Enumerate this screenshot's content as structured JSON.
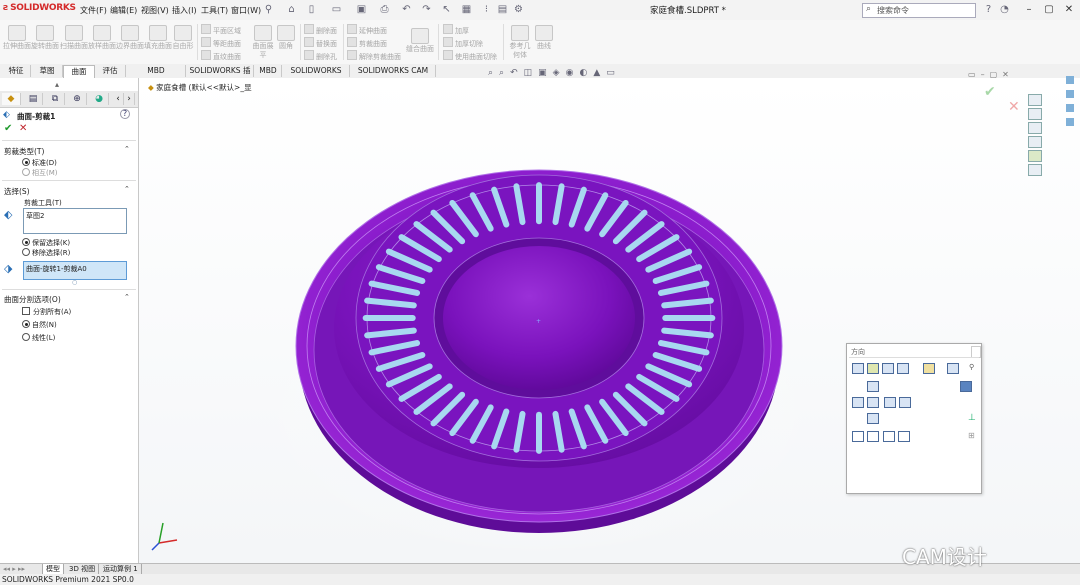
{
  "app": {
    "logo": "SOLIDWORKS",
    "document_title": "家庭食槽.SLDPRT *"
  },
  "menu": [
    "文件(F)",
    "编辑(E)",
    "视图(V)",
    "插入(I)",
    "工具(T)",
    "窗口(W)"
  ],
  "search": {
    "placeholder": "搜索命令"
  },
  "ribbon": {
    "large": [
      "拉伸曲面",
      "旋转曲面",
      "扫描曲面",
      "放样曲面",
      "边界曲面",
      "填充曲面",
      "自由形"
    ],
    "small_a": [
      "平面区域",
      "等距曲面",
      "直纹曲面"
    ],
    "large_b": [
      "曲面展平",
      "圆角"
    ],
    "small_b": [
      "删除面",
      "替换面",
      "删除孔"
    ],
    "small_c": [
      "延伸曲面",
      "剪裁曲面",
      "解除剪裁曲面"
    ],
    "large_c": "缝合曲面",
    "small_d": [
      "加厚",
      "加厚切除",
      "使用曲面切除"
    ],
    "large_d": [
      "参考几何体",
      "曲线"
    ]
  },
  "tabs": [
    "特征",
    "草图",
    "曲面",
    "评估",
    "MBD Dimensions",
    "SOLIDWORKS 插件",
    "MBD",
    "SOLIDWORKS CAM",
    "SOLIDWORKS CAM TBM"
  ],
  "active_tab": "曲面",
  "panel": {
    "title": "曲面-剪裁1",
    "trim_type": {
      "header": "剪裁类型(T)",
      "options": [
        "标准(D)",
        "相互(M)"
      ],
      "selected": "标准(D)"
    },
    "selection": {
      "header": "选择(S)",
      "trim_tool_label": "剪裁工具(T)",
      "trim_tool_value": "草图2",
      "options": [
        "保留选择(K)",
        "移除选择(R)"
      ],
      "selected": "保留选择(K)",
      "faces_value": "曲面-旋转1-剪裁A0"
    },
    "split": {
      "header": "曲面分割选项(O)",
      "split_all": "分割所有(A)",
      "options": [
        "自然(N)",
        "线性(L)"
      ],
      "selected": "自然(N)"
    }
  },
  "breadcrumb": "家庭食槽  (默认<<默认>_显",
  "orientation": {
    "title": "方向"
  },
  "model_tabs": [
    "模型",
    "3D 视图",
    "运动算例 1"
  ],
  "status": {
    "text": "SOLIDWORKS Premium 2021 SP0.0"
  },
  "watermark": "CAM设计",
  "colors": {
    "part": "#8a14c8",
    "slot": "#a8d8f0",
    "accent": "#d42a2a"
  }
}
